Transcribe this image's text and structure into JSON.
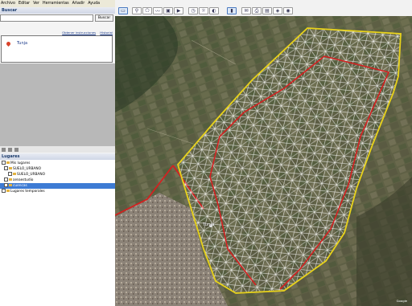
{
  "menu": {
    "items": [
      "Archivo",
      "Editar",
      "Ver",
      "Herramientas",
      "Añadir",
      "Ayuda"
    ]
  },
  "toolbar": {
    "icons": [
      "sidebar-icon",
      "placemark-icon",
      "polygon-icon",
      "path-icon",
      "overlay-icon",
      "tour-icon",
      "history-icon",
      "sun-icon",
      "planets-icon",
      "ruler-icon",
      "email-icon",
      "print-icon",
      "save-image-icon",
      "maps-icon",
      "earth-gallery-icon"
    ]
  },
  "search": {
    "title": "Buscar",
    "value": "",
    "button": "Buscar",
    "link_directions": "Obtener instrucciones",
    "link_history": "Historial"
  },
  "results": {
    "item": "Tunja"
  },
  "places": {
    "title": "Lugares",
    "items": [
      {
        "label": "Mis lugares",
        "level": 0
      },
      {
        "label": "SUELO_URBANO",
        "level": 1
      },
      {
        "label": "SUELO_URBANO",
        "level": 2
      },
      {
        "label": "areaestudio",
        "level": 1
      },
      {
        "label": "cuencas",
        "level": 1
      },
      {
        "label": "Lugares temporales",
        "level": 0
      }
    ]
  },
  "map": {
    "city_label": "Tunja",
    "coords": "Google"
  },
  "colors": {
    "boundary": "#e8d21a",
    "urban": "#e02020",
    "mesh": "#ffffff",
    "selection": "#3d7bd4"
  }
}
